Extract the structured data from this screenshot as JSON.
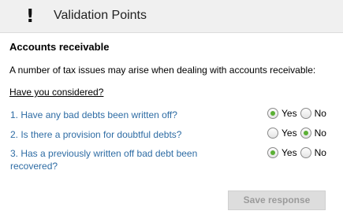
{
  "header": {
    "icon": "exclamation-icon",
    "icon_glyph": "!",
    "title": "Validation Points"
  },
  "section": {
    "title": "Accounts receivable",
    "intro": "A number of tax issues may arise when dealing with accounts receivable:",
    "consider_label": "Have you considered?"
  },
  "questions": [
    {
      "text": "1. Have any bad debts been written off?",
      "selected": "Yes"
    },
    {
      "text": "2. Is there a provision for doubtful debts?",
      "selected": "No"
    },
    {
      "text": "3. Has a previously written off bad debt been recovered?",
      "selected": "Yes"
    }
  ],
  "options": {
    "yes": "Yes",
    "no": "No"
  },
  "actions": {
    "save_label": "Save response",
    "save_enabled": false
  },
  "colors": {
    "question_text": "#2e6ca4",
    "radio_selected": "#5bb035",
    "header_bg": "#f0f0f0"
  }
}
